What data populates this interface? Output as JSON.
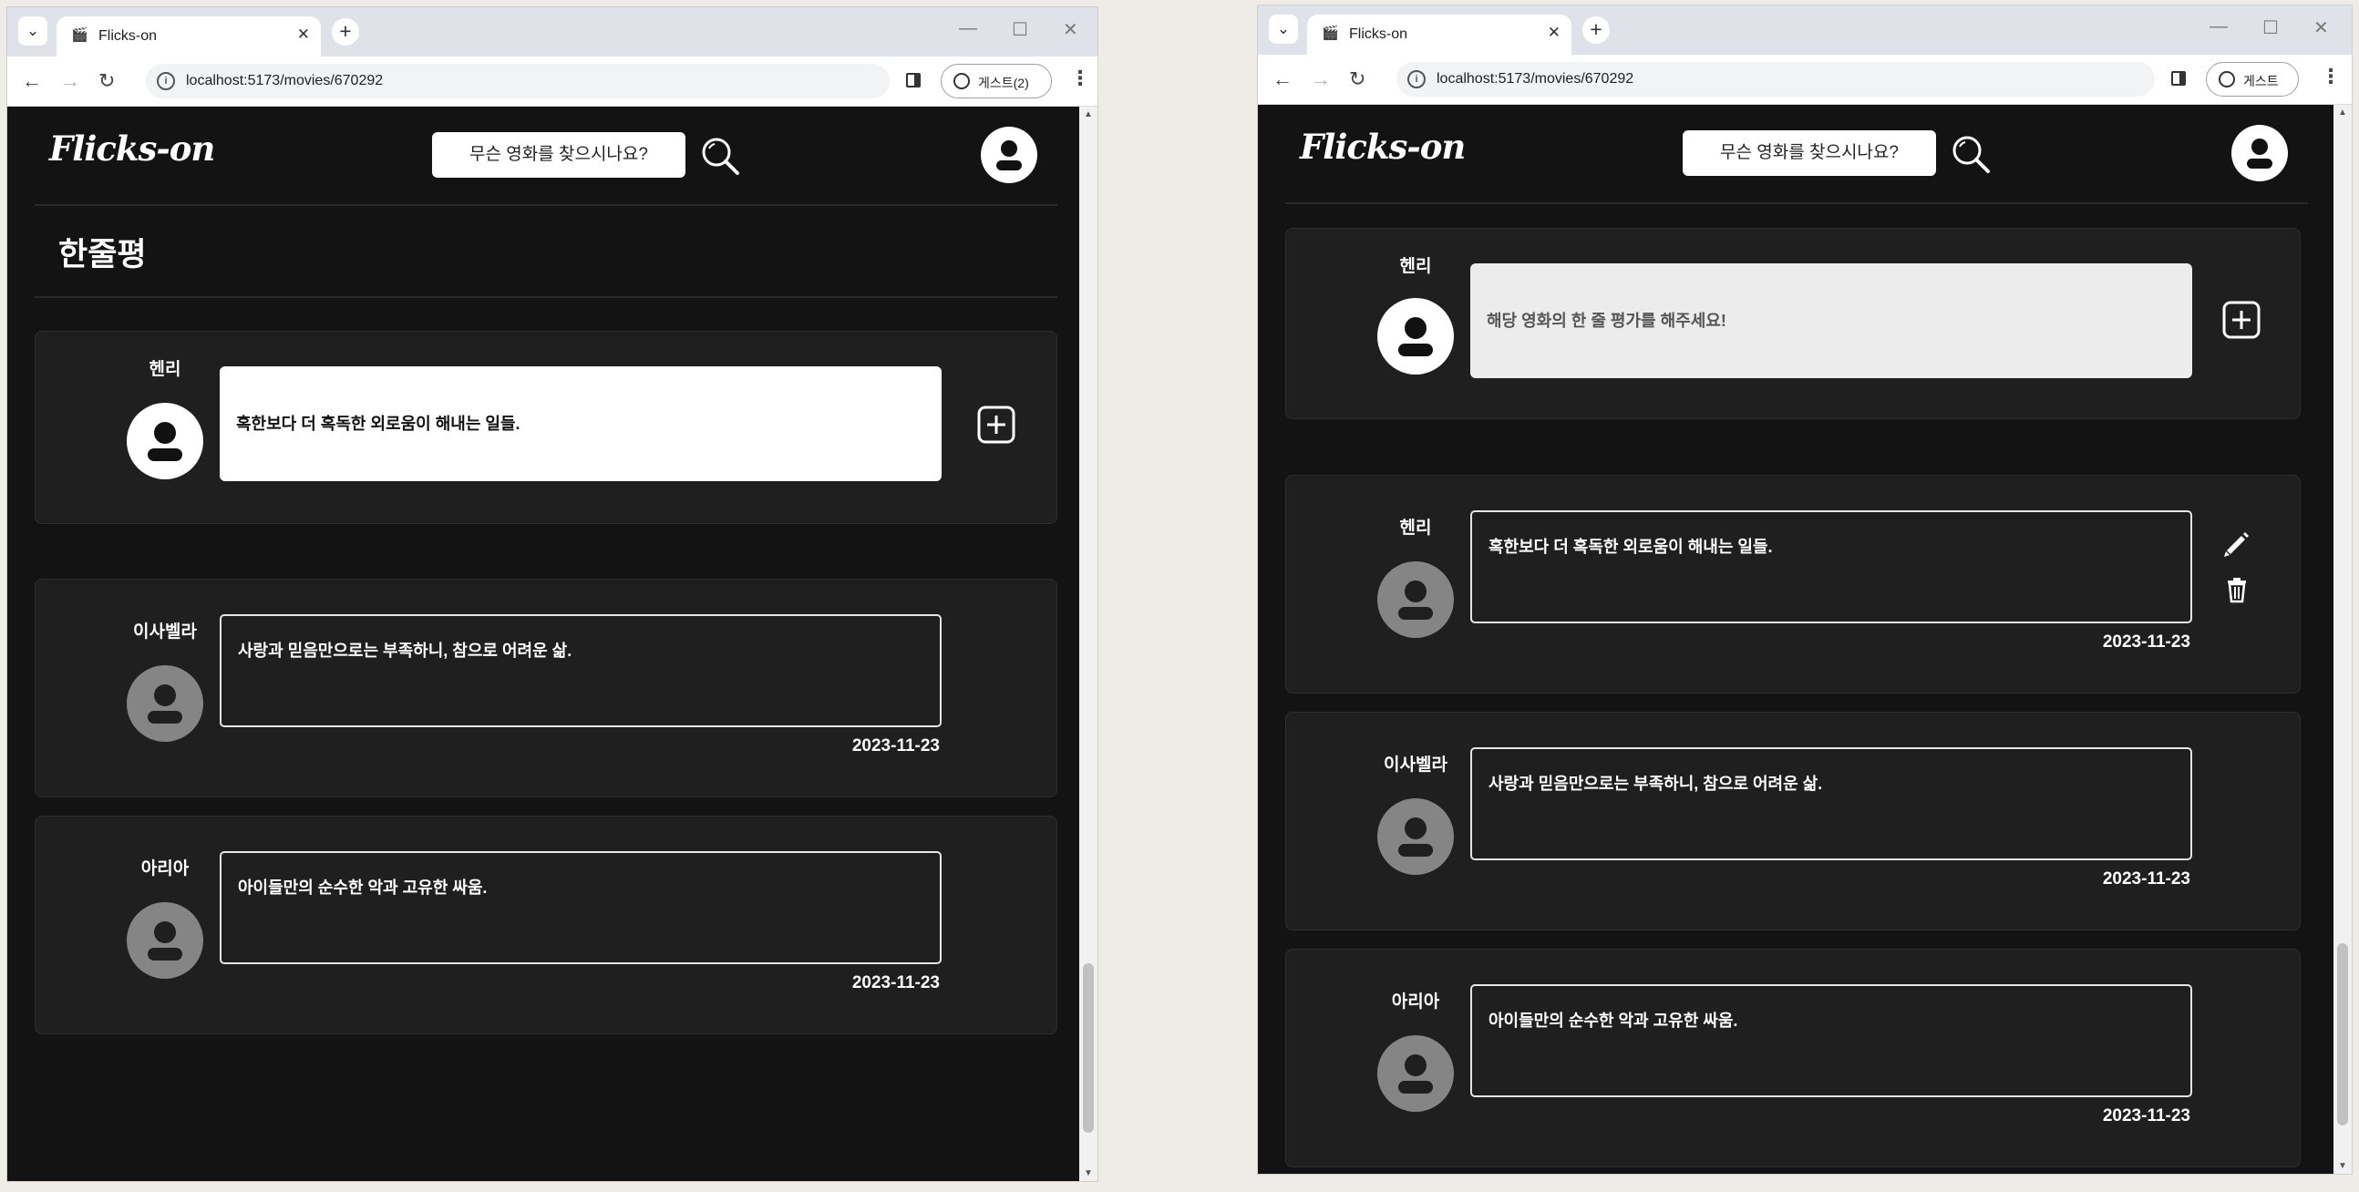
{
  "browser": {
    "tab_title": "Flicks-on",
    "url": "localhost:5173/movies/670292",
    "profile_label_left": "게스트(2)",
    "profile_label_right": "게스트"
  },
  "header": {
    "logo": "Flicks-on",
    "search_placeholder": "무슨 영화를 찾으시나요?"
  },
  "left_window": {
    "section_title": "한줄평",
    "my_review": {
      "username": "헨리",
      "text": "혹한보다 더 혹독한 외로움이 해내는 일들."
    },
    "reviews": [
      {
        "username": "이사벨라",
        "text": "사랑과 믿음만으로는 부족하니, 참으로 어려운 삶.",
        "date": "2023-11-23"
      },
      {
        "username": "아리아",
        "text": "아이들만의 순수한 악과 고유한 싸움.",
        "date": "2023-11-23"
      }
    ]
  },
  "right_window": {
    "new_review": {
      "username": "헨리",
      "placeholder": "해당 영화의 한 줄 평가를 해주세요!"
    },
    "reviews": [
      {
        "username": "헨리",
        "text": "혹한보다 더 혹독한 외로움이 해내는 일들.",
        "date": "2023-11-23"
      },
      {
        "username": "이사벨라",
        "text": "사랑과 믿음만으로는 부족하니, 참으로 어려운 삶.",
        "date": "2023-11-23"
      },
      {
        "username": "아리아",
        "text": "아이들만의 순수한 악과 고유한 싸움.",
        "date": "2023-11-23"
      }
    ]
  },
  "colors": {
    "page_bg": "#131313",
    "card_bg": "#1f1f1f",
    "avatar_gray": "#858585",
    "desktop_bg": "#efebe6"
  },
  "icons": [
    "search-icon",
    "user-icon",
    "add-square-icon",
    "pencil-icon",
    "trash-icon"
  ]
}
